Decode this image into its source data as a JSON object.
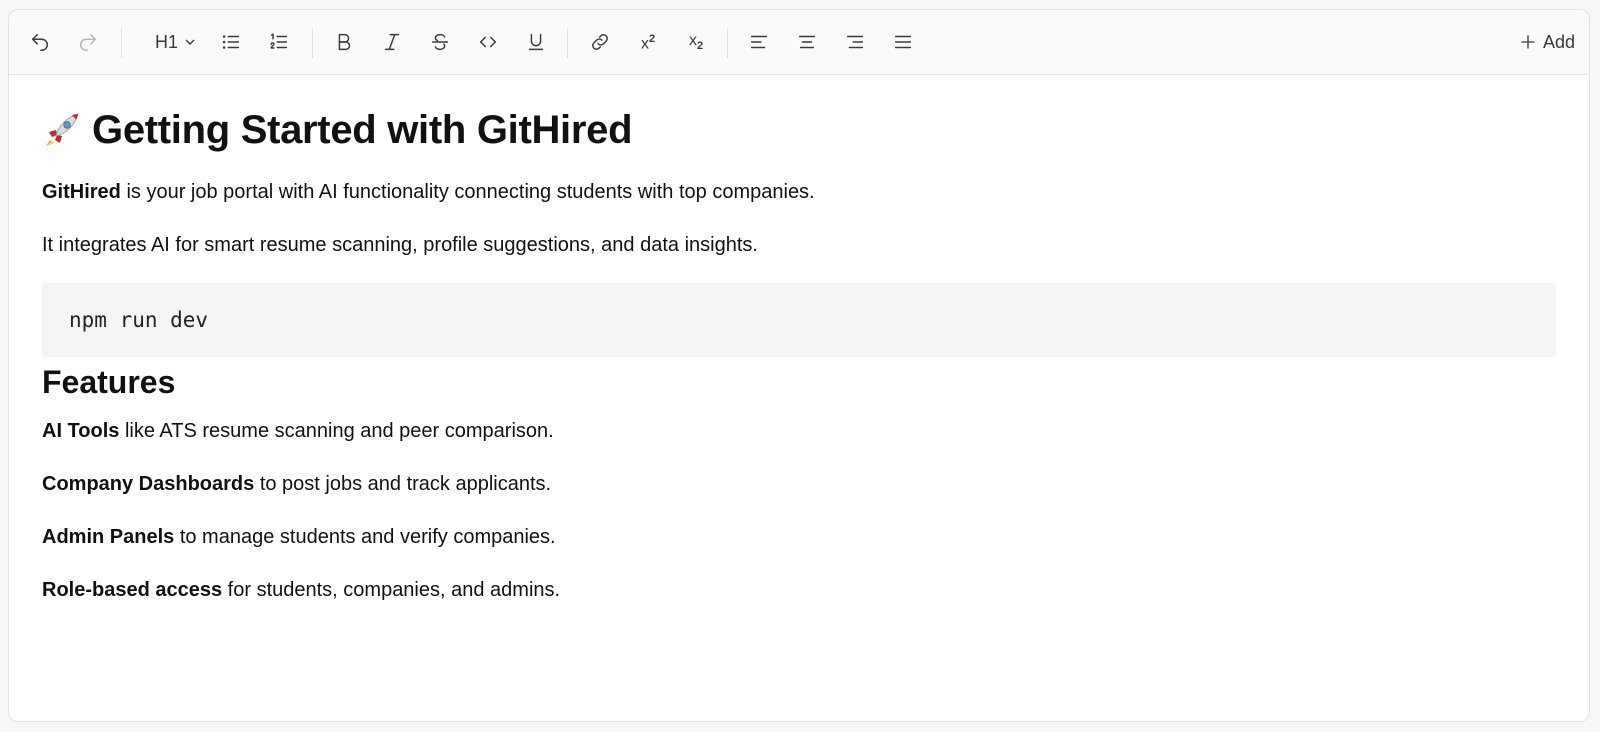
{
  "toolbar": {
    "heading_value": "H1",
    "add_label": "Add",
    "icons": [
      "undo-icon",
      "redo-icon",
      "chevron-down-icon",
      "bullet-list-icon",
      "ordered-list-icon",
      "bold-icon",
      "italic-icon",
      "strikethrough-icon",
      "code-icon",
      "underline-icon",
      "link-icon",
      "superscript-icon",
      "subscript-icon",
      "align-left-icon",
      "align-center-icon",
      "align-right-icon",
      "align-justify-icon",
      "plus-icon"
    ]
  },
  "doc": {
    "title_emoji": "🚀",
    "title_text": "Getting Started with GitHired",
    "intro": {
      "bold": "GitHired",
      "rest": " is your job portal with AI functionality connecting students with top companies."
    },
    "integrates": "It integrates AI for smart resume scanning, profile suggestions, and data insights.",
    "code": "npm run dev",
    "features_heading": "Features",
    "features": [
      {
        "bold": "AI Tools",
        "rest": " like ATS resume scanning and peer comparison."
      },
      {
        "bold": "Company Dashboards",
        "rest": " to post jobs and track applicants."
      },
      {
        "bold": "Admin Panels",
        "rest": " to manage students and verify companies."
      },
      {
        "bold": "Role-based access",
        "rest": " for students, companies, and admins."
      }
    ]
  },
  "colors": {
    "toolbar_bg": "#fafafa",
    "code_bg": "#f4f4f4",
    "text": "#111111",
    "icon": "#3a3a3a",
    "disabled_icon": "#b5b5b5"
  }
}
